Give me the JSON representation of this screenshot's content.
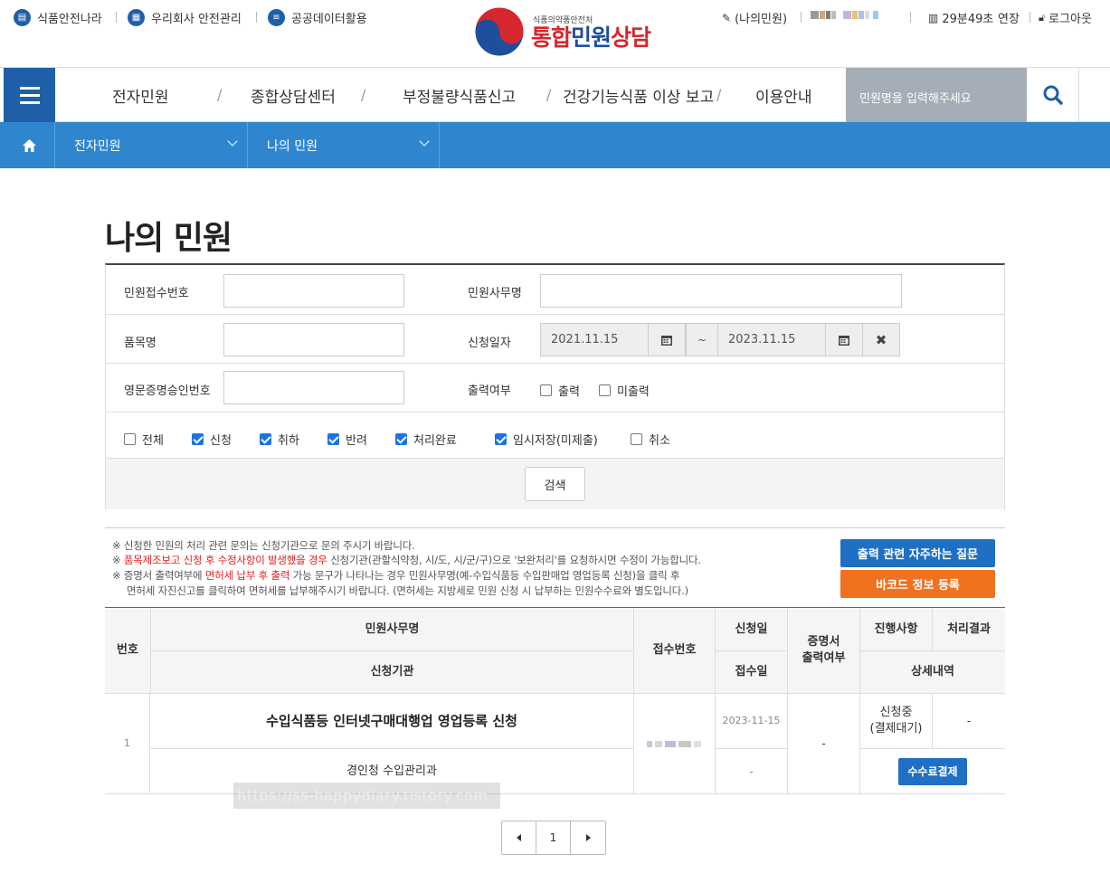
{
  "util": {
    "left_links": [
      "식품안전나라",
      "우리회사 안전관리",
      "공공데이터활용"
    ],
    "logo_sub": "식품의약품안전처",
    "logo_main": "통합민원상담",
    "my_link": "(나의민원)",
    "session_time": "29분49초",
    "extend": "연장",
    "logout": "로그아웃"
  },
  "gnb": {
    "items": [
      "전자민원",
      "종합상담센터",
      "부정불량식품신고",
      "건강기능식품 이상 보고",
      "이용안내"
    ],
    "search_placeholder": "민원명을 입력해주세요"
  },
  "location": {
    "items": [
      "전자민원",
      "나의 민원"
    ]
  },
  "page_title": "나의 민원",
  "form": {
    "label_receipt_no": "민원접수번호",
    "label_affair_name": "민원사무명",
    "label_item_name": "품목명",
    "label_apply_date": "신청일자",
    "date_from": "2021.11.15",
    "date_sep": "~",
    "date_to": "2023.11.15",
    "label_cert_no": "영문증명승인번호",
    "label_print": "출력여부",
    "print_options": [
      {
        "label": "출력",
        "checked": false
      },
      {
        "label": "미출력",
        "checked": false
      }
    ],
    "status_options": [
      {
        "label": "전체",
        "checked": false
      },
      {
        "label": "신청",
        "checked": true
      },
      {
        "label": "취하",
        "checked": true
      },
      {
        "label": "반려",
        "checked": true
      },
      {
        "label": "처리완료",
        "checked": true
      },
      {
        "label": "임시저장(미제출)",
        "checked": true
      },
      {
        "label": "취소",
        "checked": false
      }
    ],
    "search_button": "검색"
  },
  "notes": {
    "line1": "※ 신청한 민원의 처리 관련 문의는 신청기관으로 문의 주시기 바랍니다.",
    "line2_prefix": "※ ",
    "line2_red": "품목제조보고 신청 후 수정사항이 발생했을 경우",
    "line2_rest": " 신청기관(관할식약청, 시/도, 시/군/구)으로 '보완처리'를 요청하시면 수정이 가능합니다.",
    "line3_prefix": "※ 증명서 출력여부에 ",
    "line3_red": "면허세 납부 후 출력",
    "line3_rest": " 가능 문구가 나타나는 경우 민원사무명(예-수입식품등 수입판매업 영업등록 신청)을 클릭 후",
    "line4": "면허세 자진신고를 클릭하여 면허세를 납부해주시기 바랍니다. (면허세는 지방세로 민원 신청 시 납부하는 민원수수료와 별도입니다.)",
    "faq_button": "출력 관련 자주하는 질문",
    "barcode_button": "바코드 정보 등록"
  },
  "table": {
    "headers": {
      "no": "번호",
      "affair_name": "민원사무명",
      "agency": "신청기관",
      "receipt_no": "접수번호",
      "apply_date": "신청일",
      "receive_date": "접수일",
      "cert_print": "증명서\n출력여부",
      "progress": "진행사항",
      "result": "처리결과",
      "detail": "상세내역"
    },
    "rows": [
      {
        "no": "1",
        "affair_name": "수입식품등 인터넷구매대행업 영업등록 신청",
        "agency": "경인청 수입관리과",
        "apply_date": "2023-11-15",
        "receive_date": "-",
        "cert_print": "-",
        "progress": "신청중\n(결제대기)",
        "result": "-",
        "pay_button": "수수료결제"
      }
    ]
  },
  "watermark": "https://ss-happydiary.tistory.com",
  "pager": {
    "current": "1"
  },
  "colors": {
    "brand_blue": "#1f5fa8",
    "loc_blue": "#2f86cf",
    "orange": "#f0711e",
    "red": "#e02020"
  }
}
